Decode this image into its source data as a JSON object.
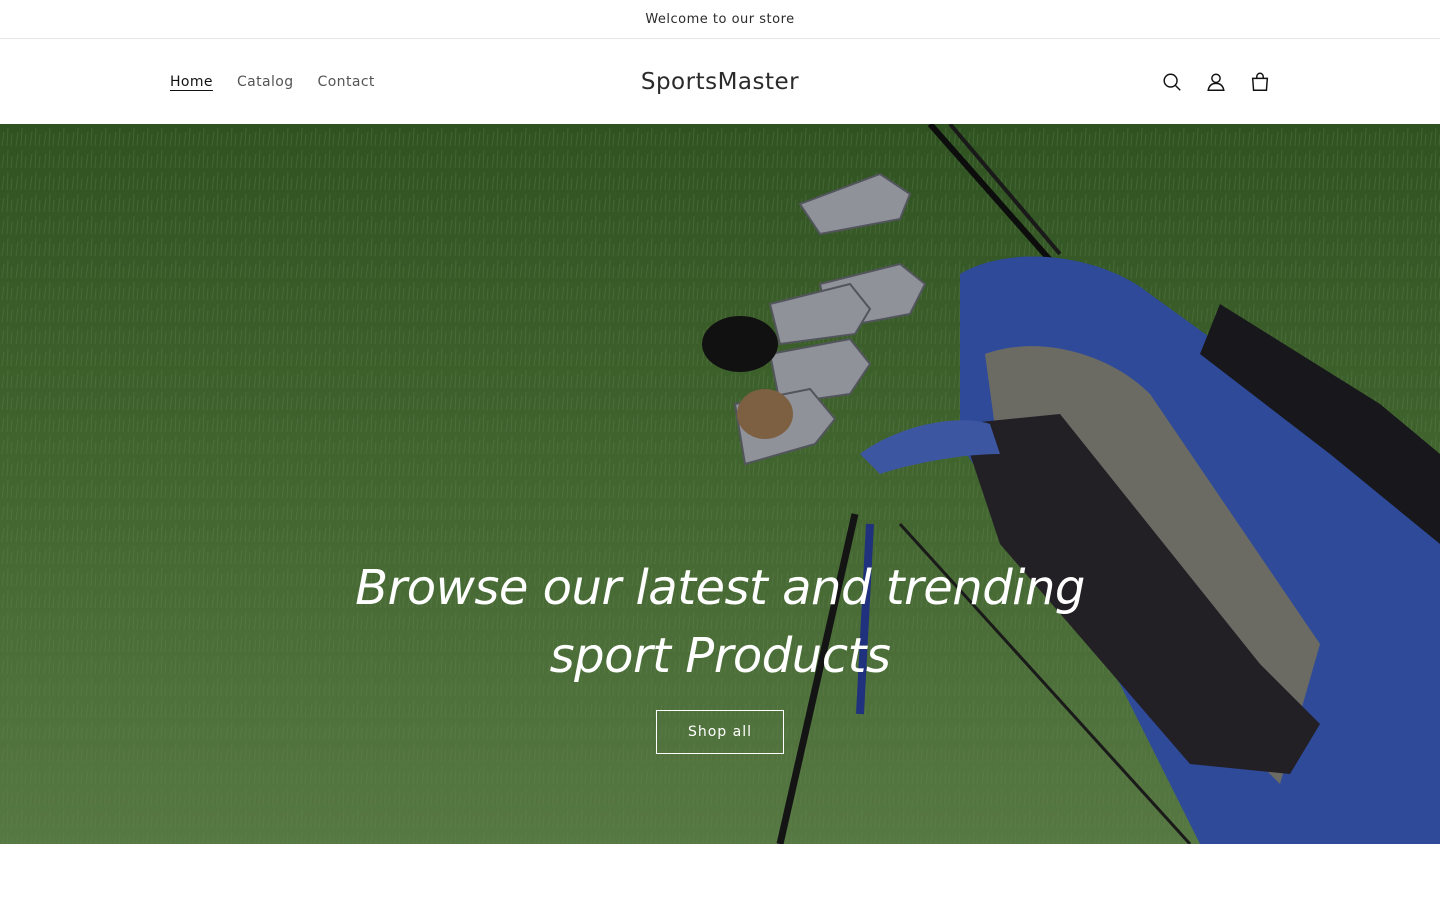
{
  "announcement": {
    "text": "Welcome to our store"
  },
  "header": {
    "nav": [
      {
        "label": "Home",
        "active": true
      },
      {
        "label": "Catalog",
        "active": false
      },
      {
        "label": "Contact",
        "active": false
      }
    ],
    "logo": "SportsMaster",
    "icons": [
      "search-icon",
      "account-icon",
      "cart-icon"
    ]
  },
  "hero": {
    "title": "Browse our latest and trending sport Products",
    "button_label": "Shop all",
    "image_description_colors": {
      "grass": "#4f7c3a",
      "bag_blue": "#3b5fc4",
      "bag_gray": "#8a8a80"
    }
  }
}
